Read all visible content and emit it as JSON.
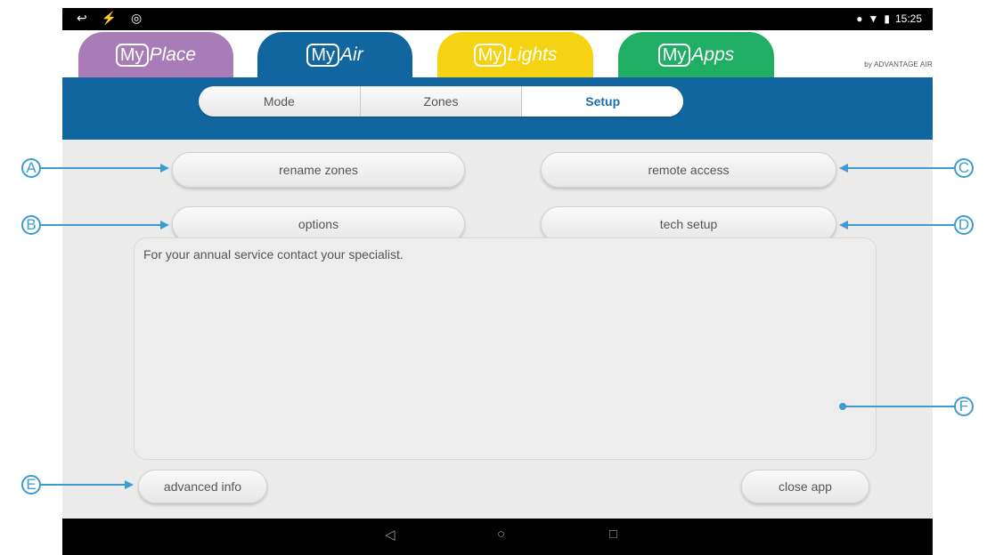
{
  "status_bar": {
    "left_icons": "↩ ⚡ ◎",
    "time": "15:25",
    "icons": [
      "do-not-disturb-icon",
      "wifi-icon",
      "battery-icon"
    ]
  },
  "tabs": [
    {
      "my": "My",
      "name": "Place",
      "color": "#a97cb8"
    },
    {
      "my": "My",
      "name": "Air",
      "color": "#1166a0"
    },
    {
      "my": "My",
      "name": "Lights",
      "color": "#f6d312"
    },
    {
      "my": "My",
      "name": "Apps",
      "color": "#1fae64"
    }
  ],
  "brand": "by ADVANTAGE AIR",
  "segments": [
    "Mode",
    "Zones",
    "Setup"
  ],
  "active_segment": "Setup",
  "buttons": {
    "rename_zones": "rename zones",
    "remote_access": "remote access",
    "options": "options",
    "tech_setup": "tech setup",
    "advanced_info": "advanced info",
    "close_app": "close app"
  },
  "info_text": "For your annual service contact your specialist.",
  "nav": {
    "back": "◁",
    "home": "○",
    "recents": "□"
  },
  "callouts": {
    "a": "A",
    "b": "B",
    "c": "C",
    "d": "D",
    "e": "E",
    "f": "F"
  }
}
